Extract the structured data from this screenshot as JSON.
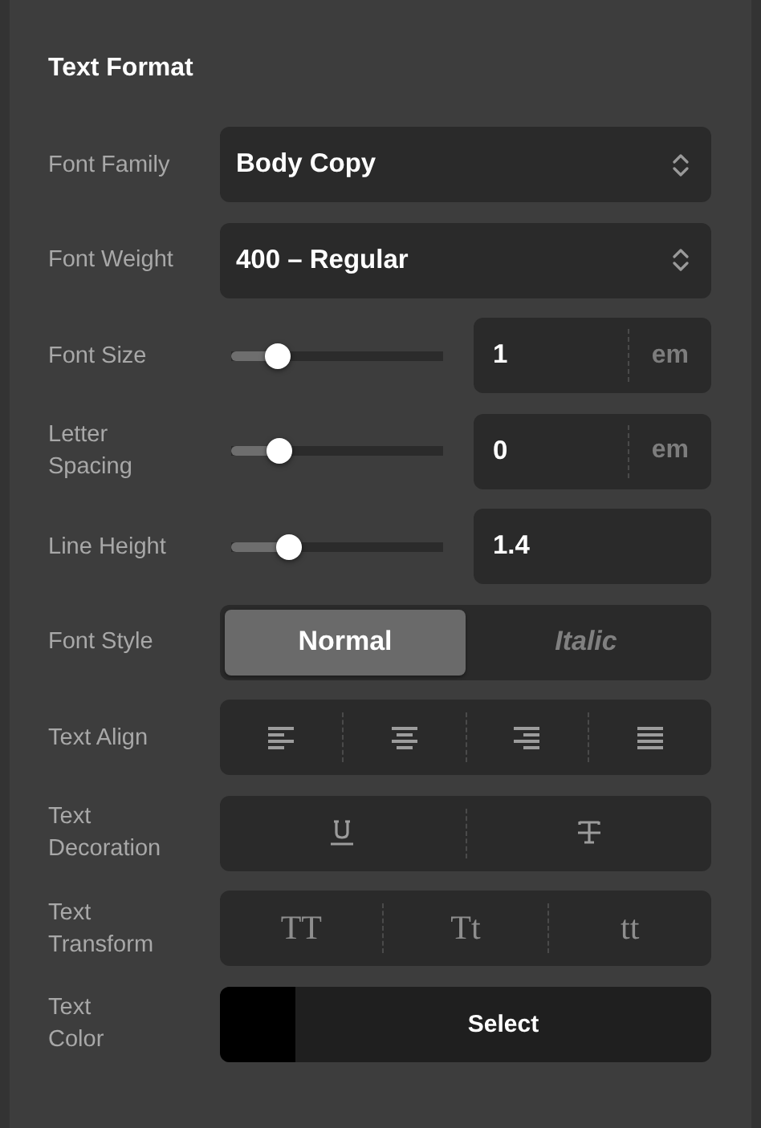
{
  "title": "Text Format",
  "rows": [
    {
      "kind": "select",
      "label": "Font Family",
      "value": "Body Copy"
    },
    {
      "kind": "select",
      "label": "Font Weight",
      "value": "400 – Regular"
    },
    {
      "kind": "slider",
      "label": "Font Size",
      "level": 0.22,
      "value": "1",
      "unit": "em"
    },
    {
      "kind": "slider",
      "label": "Letter Spacing",
      "level": 0.23,
      "value": "0",
      "unit": "em"
    },
    {
      "kind": "slider",
      "label": "Line Height",
      "level": 0.27,
      "value": "1.4"
    },
    {
      "kind": "segmented",
      "label": "Font Style",
      "options": [
        {
          "label": "Normal",
          "selected": true
        },
        {
          "label": "Italic",
          "selected": false
        }
      ]
    },
    {
      "kind": "align",
      "label": "Text Align"
    },
    {
      "kind": "decoration",
      "label": "Text Decoration"
    },
    {
      "kind": "transform",
      "label": "Text Transform",
      "options": [
        "TT",
        "Tt",
        "tt"
      ]
    },
    {
      "kind": "color",
      "label": "Text\nColor",
      "color": "#000000",
      "button": "Select"
    }
  ]
}
